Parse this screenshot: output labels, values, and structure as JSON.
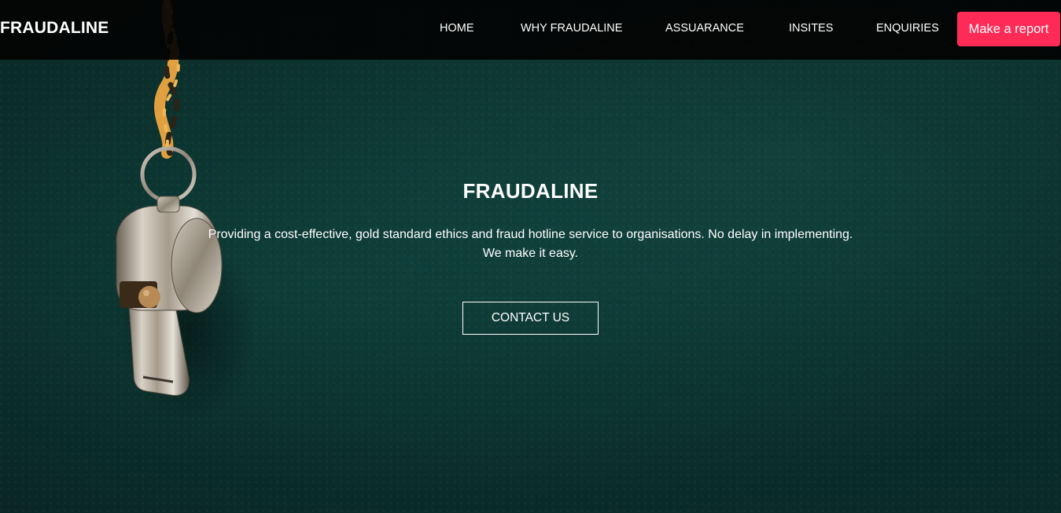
{
  "header": {
    "logo": "FRAUDALINE",
    "nav": [
      {
        "label": "HOME"
      },
      {
        "label": "WHY FRAUDALINE"
      },
      {
        "label": "ASSUARANCE"
      },
      {
        "label": "INSITES"
      },
      {
        "label": "ENQUIRIES"
      }
    ],
    "cta_label": "Make a report"
  },
  "hero": {
    "title": "FRAUDALINE",
    "subtitle": "Providing a cost-effective, gold standard ethics and fraud hotline service to organisations. No delay in implementing. We make it easy.",
    "button_label": "CONTACT US",
    "image_subject": "whistle-on-cord"
  },
  "colors": {
    "navbar_bg": "#030303",
    "accent": "#ff2b56",
    "hero_bg": "#0f3f3a",
    "text": "#ffffff"
  }
}
